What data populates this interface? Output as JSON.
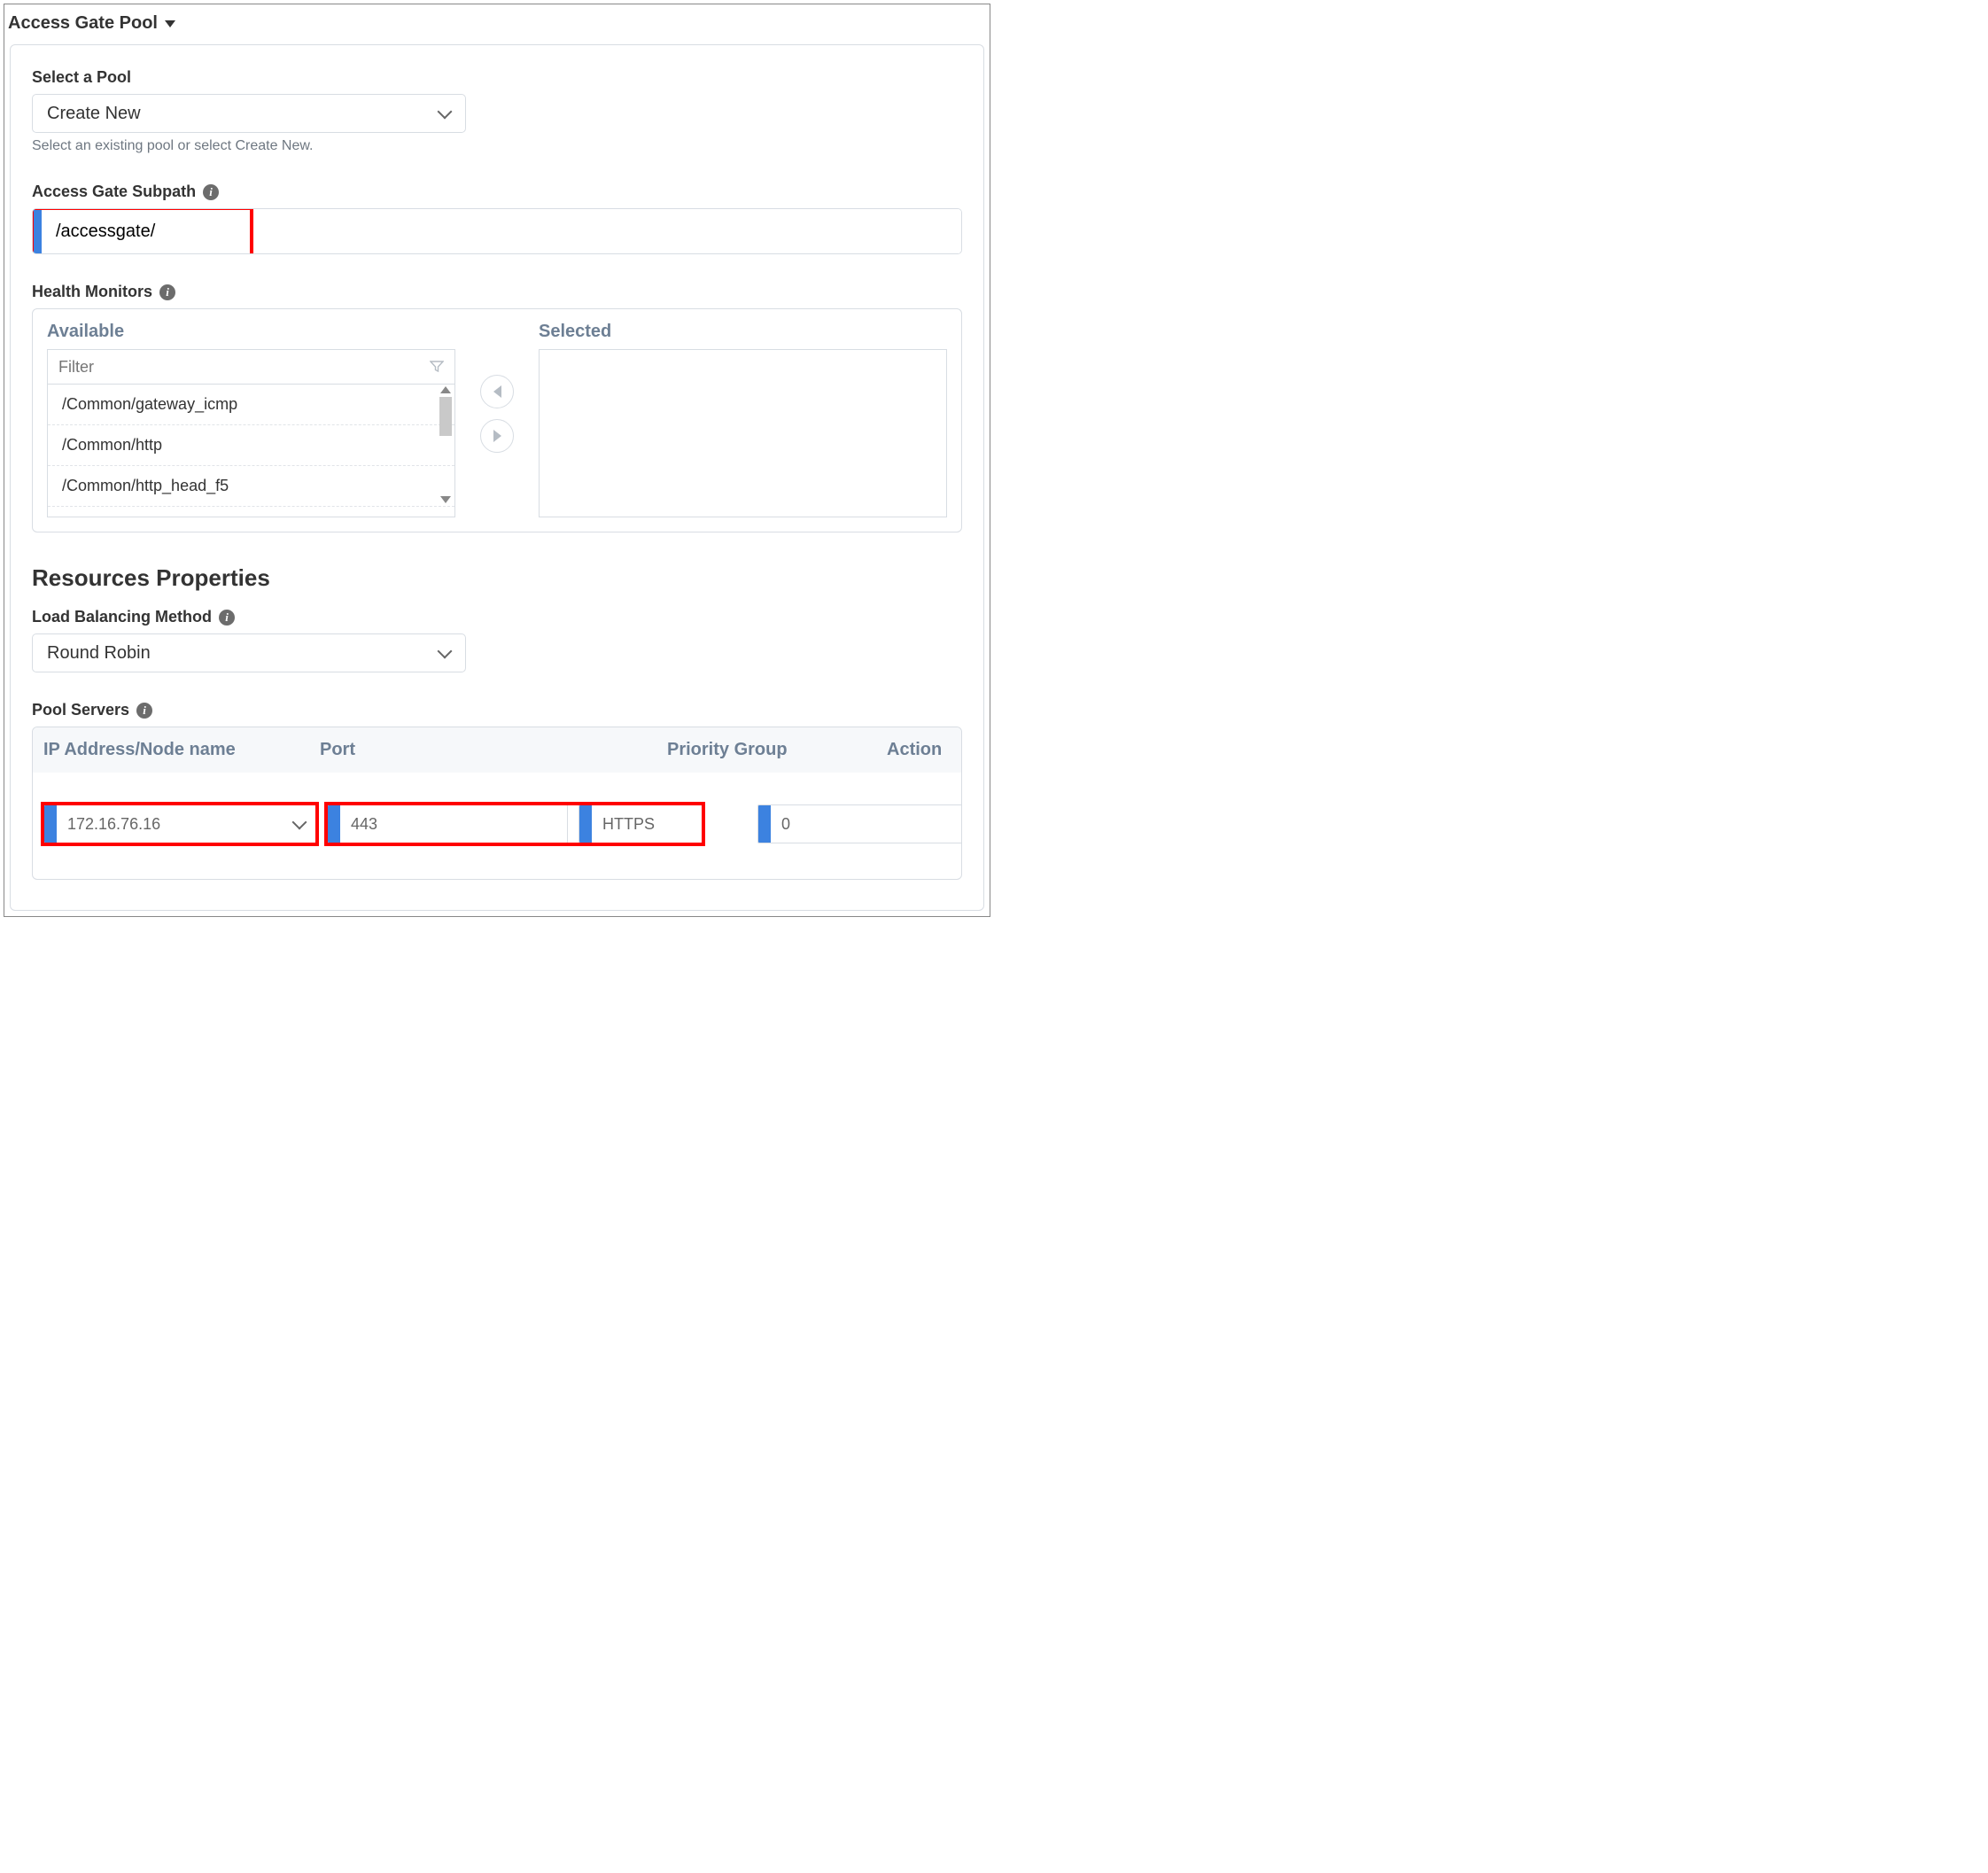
{
  "header": {
    "title": "Access Gate Pool"
  },
  "pool_select": {
    "label": "Select a Pool",
    "value": "Create New",
    "help": "Select an existing pool or select Create New."
  },
  "subpath": {
    "label": "Access Gate Subpath",
    "value": "/accessgate/"
  },
  "health": {
    "label": "Health Monitors",
    "available_label": "Available",
    "selected_label": "Selected",
    "filter_placeholder": "Filter",
    "items": [
      "/Common/gateway_icmp",
      "/Common/http",
      "/Common/http_head_f5"
    ]
  },
  "resources_heading": "Resources Properties",
  "lb": {
    "label": "Load Balancing Method",
    "value": "Round Robin"
  },
  "pool_servers": {
    "label": "Pool Servers",
    "columns": {
      "ip": "IP Address/Node name",
      "port": "Port",
      "pg": "Priority Group",
      "action": "Action"
    },
    "row": {
      "ip": "172.16.76.16",
      "port": "443",
      "proto": "HTTPS",
      "pg": "0"
    }
  }
}
